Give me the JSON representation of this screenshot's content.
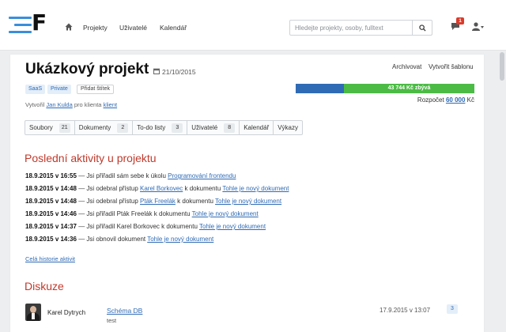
{
  "nav": {
    "links": [
      "Projekty",
      "Uživatelé",
      "Kalendář"
    ],
    "search_placeholder": "Hledejte projekty, osoby, fulltext",
    "notification_count": "1"
  },
  "project": {
    "title": "Ukázkový projekt",
    "date": "21/10/2015",
    "actions": [
      "Archivovat",
      "Vytvořit šablonu"
    ],
    "tags": [
      "SaaS",
      "Private"
    ],
    "add_tag_label": "Přidat štítek",
    "creator_prefix": "Vytvořil",
    "creator_name": "Jan Kulda",
    "creator_mid": "pro klienta",
    "client": "klient",
    "budget_progress_label": "43 744 Kč zbývá",
    "budget_spent_fraction": 0.27,
    "budget_prefix": "Rozpočet",
    "budget_amount": "60 000",
    "budget_currency": "Kč"
  },
  "tabs": [
    {
      "label": "Soubory",
      "count": "21"
    },
    {
      "label": "Dokumenty",
      "count": "2"
    },
    {
      "label": "To-do listy",
      "count": "3"
    },
    {
      "label": "Uživatelé",
      "count": "8"
    },
    {
      "label": "Kalendář",
      "count": ""
    },
    {
      "label": "Výkazy",
      "count": ""
    }
  ],
  "activities": {
    "title": "Poslední aktivity u projektu",
    "items": [
      {
        "when": "18.9.2015 v 16:55",
        "text": "— Jsi přiřadil sám sebe k úkolu",
        "link1": "Programování frontendu",
        "mid": "",
        "link2": ""
      },
      {
        "when": "18.9.2015 v 14:48",
        "text": "— Jsi odebral přístup",
        "link1": "Karel Borkovec",
        "mid": "k dokumentu",
        "link2": "Tohle je nový dokument"
      },
      {
        "when": "18.9.2015 v 14:48",
        "text": "— Jsi odebral přístup",
        "link1": "Pták Freelák",
        "mid": "k dokumentu",
        "link2": "Tohle je nový dokument"
      },
      {
        "when": "18.9.2015 v 14:46",
        "text": "— Jsi přiřadil Pták Freelák k dokumentu",
        "link1": "Tohle je nový dokument",
        "mid": "",
        "link2": ""
      },
      {
        "when": "18.9.2015 v 14:37",
        "text": "— Jsi přiřadil Karel Borkovec k dokumentu",
        "link1": "Tohle je nový dokument",
        "mid": "",
        "link2": ""
      },
      {
        "when": "18.9.2015 v 14:36",
        "text": "— Jsi obnovil dokument",
        "link1": "Tohle je nový dokument",
        "mid": "",
        "link2": ""
      }
    ],
    "history_link": "Celá historie aktivit"
  },
  "discussion": {
    "title": "Diskuze",
    "items": [
      {
        "author": "Karel Dytrych",
        "topic": "Schéma DB",
        "snippet": "test",
        "date": "17.9.2015 v 13:07",
        "count": "3"
      }
    ]
  }
}
